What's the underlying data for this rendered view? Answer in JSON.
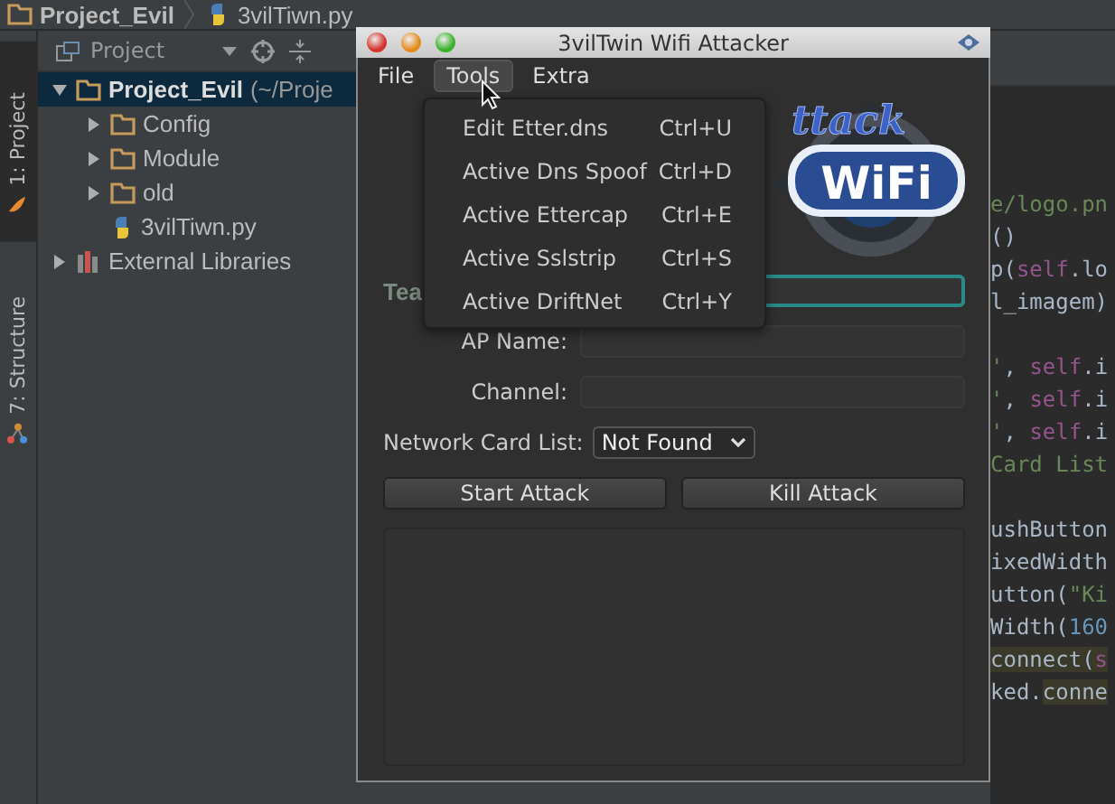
{
  "breadcrumb": [
    {
      "label": "Project_Evil",
      "kind": "folder"
    },
    {
      "label": "3vilTiwn.py",
      "kind": "python"
    }
  ],
  "tool_strip": [
    {
      "label": "1: Project",
      "kind": "project",
      "selected": true
    },
    {
      "label": "7: Structure",
      "kind": "structure",
      "selected": false
    }
  ],
  "project_panel": {
    "view": "Project",
    "tree": [
      {
        "label": "Project_Evil",
        "path": "(~/Proje",
        "kind": "folder",
        "expanded": true,
        "selected": true,
        "children": [
          {
            "label": "Config",
            "kind": "folder",
            "expanded": false,
            "selected": false
          },
          {
            "label": "Module",
            "kind": "folder",
            "expanded": false,
            "selected": false
          },
          {
            "label": "old",
            "kind": "folder",
            "expanded": false,
            "selected": false
          },
          {
            "label": "3vilTiwn.py",
            "kind": "python",
            "selected": false
          }
        ]
      },
      {
        "label": "External Libraries",
        "kind": "library",
        "expanded": false,
        "selected": false
      }
    ]
  },
  "editor": {
    "blocks": [
      {
        "lines": [
          {
            "segments": [
              {
                "text": "e/logo.pn",
                "kind": "string"
              }
            ]
          },
          {
            "segments": [
              {
                "text": "()",
                "kind": "plain"
              }
            ]
          },
          {
            "segments": [
              {
                "text": "p(",
                "kind": "plain"
              },
              {
                "text": "self",
                "kind": "self"
              },
              {
                "text": ".lo",
                "kind": "plain"
              }
            ]
          },
          {
            "segments": [
              {
                "text": "l_imagem)",
                "kind": "plain"
              }
            ]
          }
        ]
      },
      {
        "lines": [
          {
            "segments": [
              {
                "text": "'",
                "kind": "string"
              },
              {
                "text": ", ",
                "kind": "plain"
              },
              {
                "text": "self",
                "kind": "self"
              },
              {
                "text": ".i",
                "kind": "plain"
              }
            ]
          },
          {
            "segments": [
              {
                "text": "'",
                "kind": "string"
              },
              {
                "text": ", ",
                "kind": "plain"
              },
              {
                "text": "self",
                "kind": "self"
              },
              {
                "text": ".i",
                "kind": "plain"
              }
            ]
          },
          {
            "segments": [
              {
                "text": "'",
                "kind": "string"
              },
              {
                "text": ", ",
                "kind": "plain"
              },
              {
                "text": "self",
                "kind": "self"
              },
              {
                "text": ".i",
                "kind": "plain"
              }
            ]
          },
          {
            "segments": [
              {
                "text": "Card List",
                "kind": "string"
              }
            ]
          }
        ]
      },
      {
        "lines": [
          {
            "segments": [
              {
                "text": "ushButton",
                "kind": "plain"
              }
            ]
          },
          {
            "segments": [
              {
                "text": "ixedWidth",
                "kind": "plain"
              }
            ]
          },
          {
            "segments": [
              {
                "text": "utton(",
                "kind": "plain"
              },
              {
                "text": "\"Ki",
                "kind": "string"
              }
            ]
          },
          {
            "segments": [
              {
                "text": "Width(",
                "kind": "plain"
              },
              {
                "text": "160",
                "kind": "number"
              }
            ]
          },
          {
            "segments": [
              {
                "text": "connect(",
                "kind": "match"
              },
              {
                "text": "s",
                "kind": "match_self"
              }
            ]
          },
          {
            "segments": [
              {
                "text": "ked.",
                "kind": "plain"
              },
              {
                "text": "conne",
                "kind": "match"
              }
            ]
          }
        ]
      }
    ]
  },
  "dialog": {
    "title": "3vilTwin Wifi Attacker",
    "menu": [
      {
        "label": "File",
        "selected": false
      },
      {
        "label": "Tools",
        "selected": true
      },
      {
        "label": "Extra",
        "selected": false
      }
    ],
    "tools_menu": [
      {
        "label": "Edit Etter.dns",
        "shortcut": "Ctrl+U"
      },
      {
        "label": "Active Dns Spoof",
        "shortcut": "Ctrl+D"
      },
      {
        "label": "Active Ettercap",
        "shortcut": "Ctrl+E"
      },
      {
        "label": "Active Sslstrip",
        "shortcut": "Ctrl+S"
      },
      {
        "label": "Active DriftNet",
        "shortcut": "Ctrl+Y"
      }
    ],
    "logo": {
      "text": "ttack",
      "badge": "WiFi"
    },
    "form": [
      {
        "label": "Tea",
        "kind": "heading",
        "focused": true
      },
      {
        "label": "AP Name:",
        "kind": "field",
        "focused": false
      },
      {
        "label": "Channel:",
        "kind": "field",
        "focused": false
      }
    ],
    "network_card": {
      "label": "Network Card List:",
      "value": "Not Found"
    },
    "buttons": [
      "Start Attack",
      "Kill Attack"
    ]
  }
}
